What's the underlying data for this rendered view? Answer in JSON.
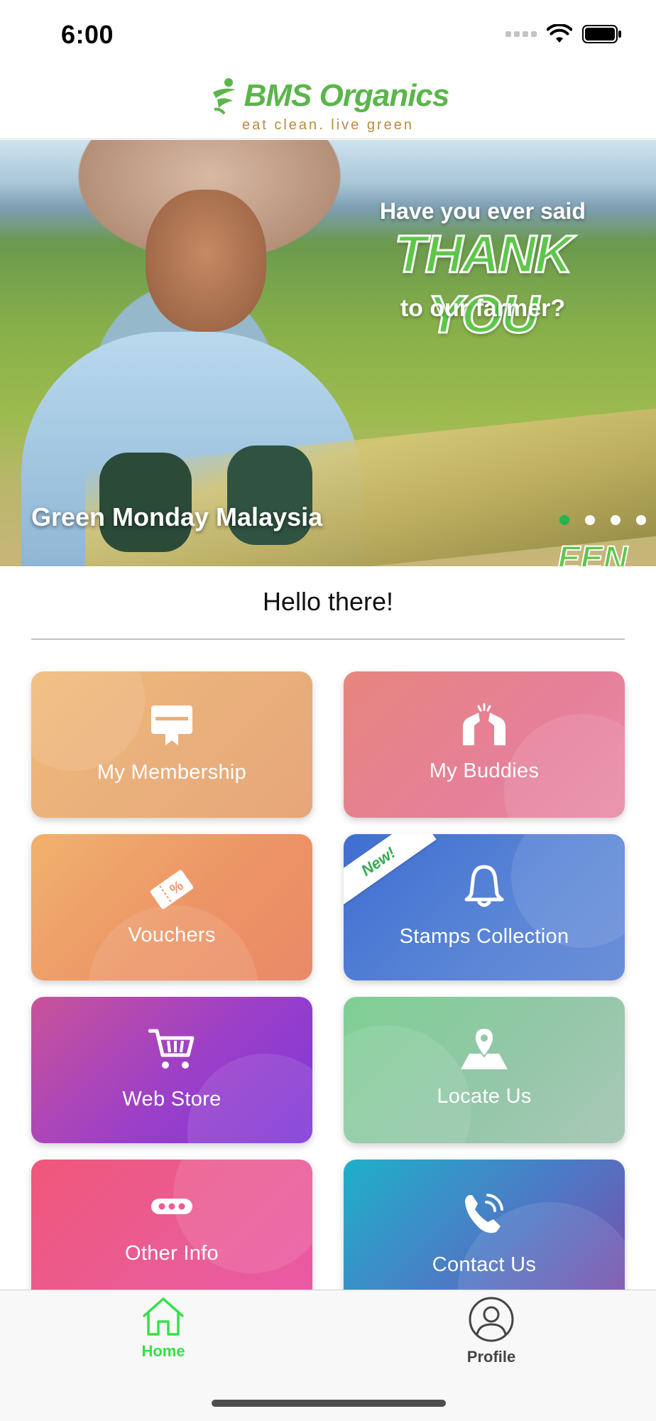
{
  "status_bar": {
    "time": "6:00"
  },
  "header": {
    "logo_text": "BMS Organics",
    "tagline": "eat clean. live green"
  },
  "hero": {
    "headline_1": "Have you ever said",
    "headline_2": "THANK YOU",
    "headline_3": "to our farmer?",
    "caption": "Green Monday Malaysia",
    "corner_text": "EEN",
    "slide_count": 4,
    "active_slide": 1,
    "active_dot_color": "#25b450"
  },
  "greeting": "Hello there!",
  "tiles": {
    "membership": {
      "label": "My Membership",
      "icon": "membership-card-icon"
    },
    "buddies": {
      "label": "My Buddies",
      "icon": "high-five-icon"
    },
    "vouchers": {
      "label": "Vouchers",
      "icon": "voucher-percent-icon"
    },
    "stamps": {
      "label": "Stamps Collection",
      "icon": "bell-icon",
      "badge": "New!"
    },
    "webstore": {
      "label": "Web Store",
      "icon": "shopping-cart-icon"
    },
    "locate": {
      "label": "Locate Us",
      "icon": "map-pin-icon"
    },
    "otherinfo": {
      "label": "Other Info",
      "icon": "more-dots-icon"
    },
    "contact": {
      "label": "Contact Us",
      "icon": "phone-call-icon"
    }
  },
  "tabbar": {
    "home": {
      "label": "Home",
      "icon": "home-icon",
      "active": true,
      "color": "#35e04a"
    },
    "profile": {
      "label": "Profile",
      "icon": "profile-icon",
      "active": false
    }
  }
}
